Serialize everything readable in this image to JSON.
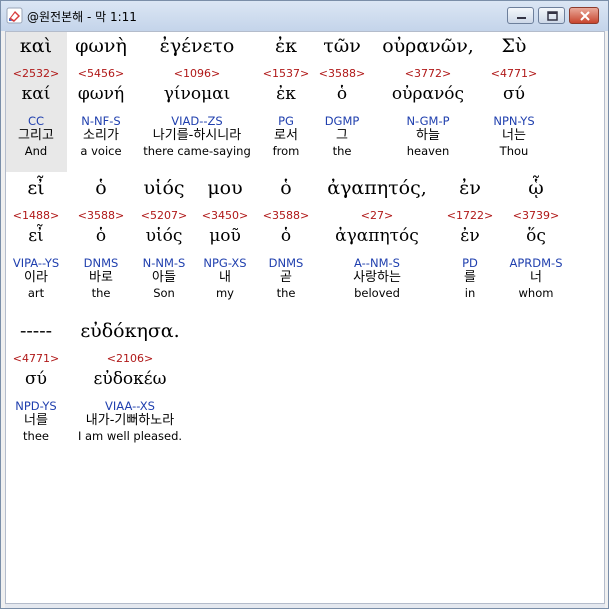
{
  "window": {
    "title": "@원전본해 - 막 1:11"
  },
  "icons": {
    "app": "bible-app-icon",
    "minimize": "minimize-icon",
    "maximize": "maximize-icon",
    "close": "close-icon"
  },
  "rows": [
    {
      "words": [
        {
          "greek": "καὶ",
          "strong": "<2532>",
          "lemma": "καί",
          "morph": "CC",
          "korean": "그리고",
          "english": "And"
        },
        {
          "greek": "φωνὴ",
          "strong": "<5456>",
          "lemma": "φωνή",
          "morph": "N-NF-S",
          "korean": "소리가",
          "english": "a voice"
        },
        {
          "greek": "ἐγένετο",
          "strong": "<1096>",
          "lemma": "γίνομαι",
          "morph": "VIAD--ZS",
          "korean": "나기를-하시니라",
          "english": "there came-saying"
        },
        {
          "greek": "ἐκ",
          "strong": "<1537>",
          "lemma": "ἐκ",
          "morph": "PG",
          "korean": "로서",
          "english": "from"
        },
        {
          "greek": "τῶν",
          "strong": "<3588>",
          "lemma": "ὁ",
          "morph": "DGMP",
          "korean": "그",
          "english": "the"
        },
        {
          "greek": "οὐρανῶν,",
          "strong": "<3772>",
          "lemma": "οὐρανός",
          "morph": "N-GM-P",
          "korean": "하늘",
          "english": "heaven"
        },
        {
          "greek": "Σὺ",
          "strong": "<4771>",
          "lemma": "σύ",
          "morph": "NPN-YS",
          "korean": "너는",
          "english": "Thou"
        }
      ]
    },
    {
      "words": [
        {
          "greek": "εἶ",
          "strong": "<1488>",
          "lemma": "εἶ",
          "morph": "VIPA--YS",
          "korean": "이라",
          "english": "art"
        },
        {
          "greek": "ὁ",
          "strong": "<3588>",
          "lemma": "ὁ",
          "morph": "DNMS",
          "korean": "바로",
          "english": "the"
        },
        {
          "greek": "υἱός",
          "strong": "<5207>",
          "lemma": "υἱός",
          "morph": "N-NM-S",
          "korean": "아들",
          "english": "Son"
        },
        {
          "greek": "μου",
          "strong": "<3450>",
          "lemma": "μοῦ",
          "morph": "NPG-XS",
          "korean": "내",
          "english": "my"
        },
        {
          "greek": "ὁ",
          "strong": "<3588>",
          "lemma": "ὁ",
          "morph": "DNMS",
          "korean": "곧",
          "english": "the"
        },
        {
          "greek": "ἀγαπητός,",
          "strong": "<27>",
          "lemma": "ἀγαπητός",
          "morph": "A--NM-S",
          "korean": "사랑하는",
          "english": "beloved"
        },
        {
          "greek": "ἐν",
          "strong": "<1722>",
          "lemma": "ἐν",
          "morph": "PD",
          "korean": "를",
          "english": "in"
        },
        {
          "greek": "ᾧ",
          "strong": "<3739>",
          "lemma": "ὅς",
          "morph": "APRDM-S",
          "korean": "너",
          "english": "whom"
        }
      ]
    },
    {
      "words": [
        {
          "greek": "-----",
          "strong": "<4771>",
          "lemma": "σύ",
          "morph": "NPD-YS",
          "korean": "너를",
          "english": "thee"
        },
        {
          "greek": "εὐδόκησα.",
          "strong": "<2106>",
          "lemma": "εὐδοκέω",
          "morph": "VIAA--XS",
          "korean": "내가-기뻐하노라",
          "english": "I am well pleased."
        }
      ]
    }
  ]
}
